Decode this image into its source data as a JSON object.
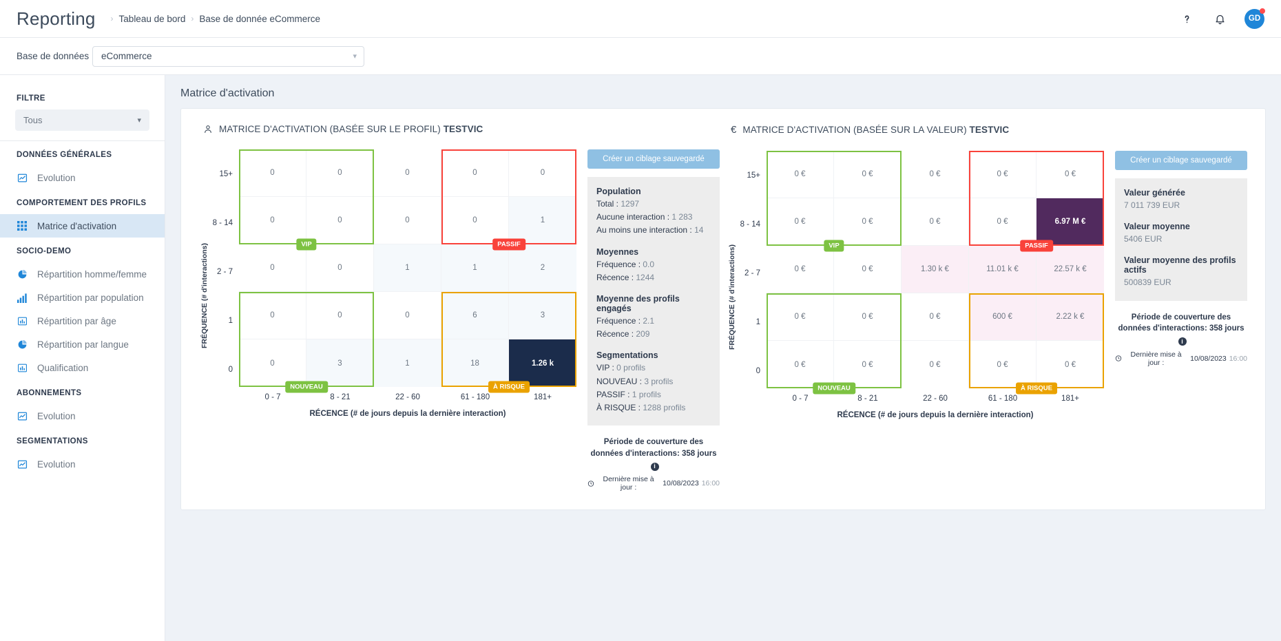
{
  "header": {
    "app_title": "Reporting",
    "breadcrumb": [
      "Tableau de bord",
      "Base de donnée eCommerce"
    ],
    "help_icon": "question-mark-icon",
    "bell_icon": "notification-bell-icon",
    "avatar_initials": "GD"
  },
  "dbbar": {
    "label": "Base de données",
    "value": "eCommerce"
  },
  "sidebar": {
    "filter_title": "FILTRE",
    "filter_value": "Tous",
    "sections": [
      {
        "title": "DONNÉES GÉNÉRALES",
        "items": [
          {
            "label": "Evolution",
            "icon": "line-chart-icon",
            "active": false
          }
        ]
      },
      {
        "title": "COMPORTEMENT DES PROFILS",
        "items": [
          {
            "label": "Matrice d'activation",
            "icon": "grid-icon",
            "active": true
          }
        ]
      },
      {
        "title": "SOCIO-DEMO",
        "items": [
          {
            "label": "Répartition homme/femme",
            "icon": "pie-chart-icon",
            "active": false
          },
          {
            "label": "Répartition par population",
            "icon": "bar-chart-icon",
            "active": false
          },
          {
            "label": "Répartition par âge",
            "icon": "column-chart-icon",
            "active": false
          },
          {
            "label": "Répartition par langue",
            "icon": "pie-chart-icon",
            "active": false
          },
          {
            "label": "Qualification",
            "icon": "column-chart-icon",
            "active": false
          }
        ]
      },
      {
        "title": "ABONNEMENTS",
        "items": [
          {
            "label": "Evolution",
            "icon": "line-chart-icon",
            "active": false
          }
        ]
      },
      {
        "title": "SEGMENTATIONS",
        "items": [
          {
            "label": "Evolution",
            "icon": "line-chart-icon",
            "active": false
          }
        ]
      }
    ]
  },
  "page": {
    "title": "Matrice d'activation"
  },
  "colors": {
    "vip": "#7dc242",
    "passif": "#f9423a",
    "nouveau": "#7dc242",
    "a_risque": "#eaa200",
    "hot_dark": "#1b2c4b",
    "hot_purple": "#512a5e",
    "accent": "#1f86d8"
  },
  "chart_data": [
    {
      "type": "heatmap",
      "id": "profile-matrix",
      "icon": "person-icon",
      "title": "MATRICE D'ACTIVATION (BASÉE SUR LE PROFIL)",
      "title_bold": "TESTVIC",
      "xlabel": "RÉCENCE (# de jours depuis la dernière interaction)",
      "ylabel": "FRÉQUENCE (# d'interactions)",
      "x_categories": [
        "0 - 7",
        "8 - 21",
        "22 - 60",
        "61 - 180",
        "181+"
      ],
      "y_categories": [
        "15+",
        "8 - 14",
        "2 - 7",
        "1",
        "0"
      ],
      "values": [
        [
          "0",
          "0",
          "0",
          "0",
          "0"
        ],
        [
          "0",
          "0",
          "0",
          "0",
          "1"
        ],
        [
          "0",
          "0",
          "1",
          "1",
          "2"
        ],
        [
          "0",
          "0",
          "0",
          "6",
          "3"
        ],
        [
          "0",
          "3",
          "1",
          "18",
          "1.26 k"
        ]
      ],
      "cell_shades": [
        [
          "none",
          "none",
          "none",
          "none",
          "none"
        ],
        [
          "none",
          "none",
          "none",
          "none",
          "light"
        ],
        [
          "none",
          "none",
          "light",
          "light",
          "light"
        ],
        [
          "none",
          "none",
          "none",
          "light",
          "light"
        ],
        [
          "none",
          "light",
          "light",
          "light",
          "dark"
        ]
      ],
      "segments": [
        {
          "label": "VIP",
          "color": "#7dc242",
          "col_start": 1,
          "col_end": 2,
          "row_start": 1,
          "row_end": 2
        },
        {
          "label": "PASSIF",
          "color": "#f9423a",
          "col_start": 4,
          "col_end": 5,
          "row_start": 1,
          "row_end": 2
        },
        {
          "label": "NOUVEAU",
          "color": "#7dc242",
          "col_start": 1,
          "col_end": 2,
          "row_start": 4,
          "row_end": 5
        },
        {
          "label": "À RISQUE",
          "color": "#eaa200",
          "col_start": 4,
          "col_end": 5,
          "row_start": 4,
          "row_end": 5
        }
      ]
    },
    {
      "type": "heatmap",
      "id": "value-matrix",
      "icon": "euro-icon",
      "title": "MATRICE D'ACTIVATION (BASÉE SUR LA VALEUR)",
      "title_bold": "TESTVIC",
      "xlabel": "RÉCENCE (# de jours depuis la dernière interaction)",
      "ylabel": "FRÉQUENCE (# d'interactions)",
      "x_categories": [
        "0 - 7",
        "8 - 21",
        "22 - 60",
        "61 - 180",
        "181+"
      ],
      "y_categories": [
        "15+",
        "8 - 14",
        "2 - 7",
        "1",
        "0"
      ],
      "values": [
        [
          "0 €",
          "0 €",
          "0 €",
          "0 €",
          "0 €"
        ],
        [
          "0 €",
          "0 €",
          "0 €",
          "0 €",
          "6.97 M €"
        ],
        [
          "0 €",
          "0 €",
          "1.30 k €",
          "11.01 k €",
          "22.57 k €"
        ],
        [
          "0 €",
          "0 €",
          "0 €",
          "600 €",
          "2.22 k €"
        ],
        [
          "0 €",
          "0 €",
          "0 €",
          "0 €",
          "0 €"
        ]
      ],
      "cell_shades": [
        [
          "none",
          "none",
          "none",
          "none",
          "none"
        ],
        [
          "none",
          "none",
          "none",
          "none",
          "purple"
        ],
        [
          "none",
          "none",
          "pink",
          "pink",
          "pink"
        ],
        [
          "none",
          "none",
          "none",
          "pink",
          "pink"
        ],
        [
          "none",
          "none",
          "none",
          "none",
          "none"
        ]
      ],
      "segments": [
        {
          "label": "VIP",
          "color": "#7dc242",
          "col_start": 1,
          "col_end": 2,
          "row_start": 1,
          "row_end": 2
        },
        {
          "label": "PASSIF",
          "color": "#f9423a",
          "col_start": 4,
          "col_end": 5,
          "row_start": 1,
          "row_end": 2
        },
        {
          "label": "NOUVEAU",
          "color": "#7dc242",
          "col_start": 1,
          "col_end": 2,
          "row_start": 4,
          "row_end": 5
        },
        {
          "label": "À RISQUE",
          "color": "#eaa200",
          "col_start": 4,
          "col_end": 5,
          "row_start": 4,
          "row_end": 5
        }
      ]
    }
  ],
  "left_panel": {
    "cta": "Créer un ciblage sauvegardé",
    "groups": [
      {
        "heading": "Population",
        "rows": [
          {
            "label": "Total :",
            "value": "1297"
          },
          {
            "label": "Aucune interaction :",
            "value": "1 283"
          },
          {
            "label": "Au moins une interaction :",
            "value": "14"
          }
        ]
      },
      {
        "heading": "Moyennes",
        "rows": [
          {
            "label": "Fréquence :",
            "value": "0.0"
          },
          {
            "label": "Récence :",
            "value": "1244"
          }
        ]
      },
      {
        "heading": "Moyenne des profils engagés",
        "rows": [
          {
            "label": "Fréquence :",
            "value": "2.1"
          },
          {
            "label": "Récence :",
            "value": "209"
          }
        ]
      },
      {
        "heading": "Segmentations",
        "rows": [
          {
            "label": "VIP :",
            "value": "0 profils"
          },
          {
            "label": "NOUVEAU :",
            "value": "3 profils"
          },
          {
            "label": "PASSIF :",
            "value": "1 profils"
          },
          {
            "label": "À RISQUE :",
            "value": "1288 profils"
          }
        ]
      }
    ],
    "coverage": "Période de couverture des données d'interactions: 358 jours",
    "updated_label": "Dernière mise à jour :",
    "updated_date": "10/08/2023",
    "updated_time": "16:00"
  },
  "right_panel": {
    "cta": "Créer un ciblage sauvegardé",
    "groups": [
      {
        "heading": "Valeur générée",
        "rows": [
          {
            "label": "",
            "value": "7 011 739 EUR"
          }
        ]
      },
      {
        "heading": "Valeur moyenne",
        "rows": [
          {
            "label": "",
            "value": "5406 EUR"
          }
        ]
      },
      {
        "heading": "Valeur moyenne des profils actifs",
        "rows": [
          {
            "label": "",
            "value": "500839 EUR"
          }
        ]
      }
    ],
    "coverage": "Période de couverture des données d'interactions: 358 jours",
    "updated_label": "Dernière mise à jour :",
    "updated_date": "10/08/2023",
    "updated_time": "16:00"
  }
}
